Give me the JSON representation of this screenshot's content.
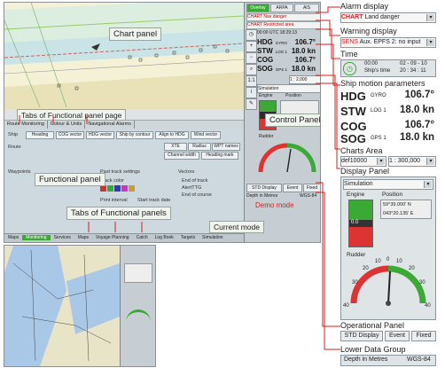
{
  "main": {
    "callouts": {
      "chart_panel": "Chart panel",
      "tabs_functional_page": "Tabs of Functional panel page",
      "control_panel": "Control Panel",
      "functional_panel": "Functional panel",
      "tabs_functional_panels": "Tabs of Functional panels",
      "current_mode": "Current mode",
      "demo_mode": "Demo mode"
    },
    "control": {
      "tabs": [
        "Overlay",
        "ARPA",
        "AIS"
      ],
      "alarm": "CHART Nav danger",
      "warning": "CHART Restricted area",
      "time_rows": [
        "00:00  UTC  18:29:13",
        "18:29:13"
      ],
      "hdg": {
        "label": "HDG",
        "src": "GYRO",
        "value": "106.7°"
      },
      "stw": {
        "label": "STW",
        "src": "LOG 1",
        "value": "18.0 kn"
      },
      "cog": {
        "label": "COG",
        "src": "",
        "value": "106.7°"
      },
      "sog": {
        "label": "SOG",
        "src": "GPS 1",
        "value": "18.0 kn"
      },
      "scale": "1 : 2,000",
      "display_mode": "Simulation",
      "engine": "Engine",
      "position": "Position",
      "rudder": "Rudder",
      "buttons": [
        "STD Display",
        "Event",
        "Fixed"
      ],
      "depth": "Depth in Metres",
      "datum": "WGS-84"
    },
    "functional_tabs": [
      "Route Monitoring",
      "Colour & Units",
      "Navigational Alarms"
    ],
    "bottom_tabs": [
      "Maps",
      "Monitoring",
      "Services",
      "Maps",
      "Voyage Planning",
      "Catch",
      "Log Book",
      "Targets",
      "Simulation"
    ],
    "fp": {
      "ship_label": "Ship",
      "ship_buttons": [
        "Heading",
        "COG vector",
        "HDG vector",
        "Ship by contour",
        "Align to HDG",
        "Wind vector"
      ],
      "route_label": "Route",
      "route_buttons": [
        "XTE",
        "Radius",
        "WPT names"
      ],
      "route_buttons2": [
        "Channel width",
        "Heading mark"
      ],
      "waypoints": "Waypoints",
      "track_settings": "Past track settings",
      "track_color": "Track color",
      "print_interval": "Print interval",
      "start_interval": "Start track date",
      "vectors": "Vectors",
      "vec_opts": [
        "End of track",
        "AlertTTG",
        "End of course"
      ]
    }
  },
  "panels": {
    "alarm_display": {
      "title": "Alarm display",
      "tag": "CHART",
      "text": "Land danger"
    },
    "warning_display": {
      "title": "Warning display",
      "tag": "SENS",
      "text": "Aux. EPFS 2: no input"
    },
    "time": {
      "title": "Time",
      "local": "00:00",
      "date": "02 - 09 - 10",
      "label": "Ship's time",
      "clock": "20 : 34 : 11"
    },
    "motion": {
      "title": "Ship motion parameters",
      "rows": [
        {
          "label": "HDG",
          "src": "GYRO",
          "value": "106.7°"
        },
        {
          "label": "STW",
          "src": "LOG 1",
          "value": "18.0 kn"
        },
        {
          "label": "COG",
          "src": "",
          "value": "106.7°"
        },
        {
          "label": "SOG",
          "src": "GPS 1",
          "value": "18.0 kn"
        }
      ]
    },
    "charts_area": {
      "title": "Charts Area",
      "chart": "def10000",
      "scale": "1 : 300,000"
    },
    "display_panel": {
      "title": "Display Panel",
      "mode": "Simulation",
      "engine": "Engine",
      "position": "Position",
      "position_values": [
        "59°39.000' N",
        "043°20.135' E"
      ],
      "engine_value": "0.0",
      "rudder": "Rudder",
      "rudder_ticks": [
        "40",
        "30",
        "20",
        "10",
        "0",
        "10",
        "20",
        "30",
        "40"
      ]
    },
    "operational_panel": {
      "title": "Operational Panel",
      "buttons": [
        "STD Display",
        "Event",
        "Fixed"
      ]
    },
    "lower_data_group": {
      "title": "Lower Data Group",
      "depth": "Depth in Metres",
      "datum": "WGS-84"
    }
  },
  "colors": {
    "alarm_red": "#d81e1e",
    "accent_green": "#3aa935",
    "panel_bg": "#dfe4e7",
    "chart_sea": "#f4f1d7"
  }
}
